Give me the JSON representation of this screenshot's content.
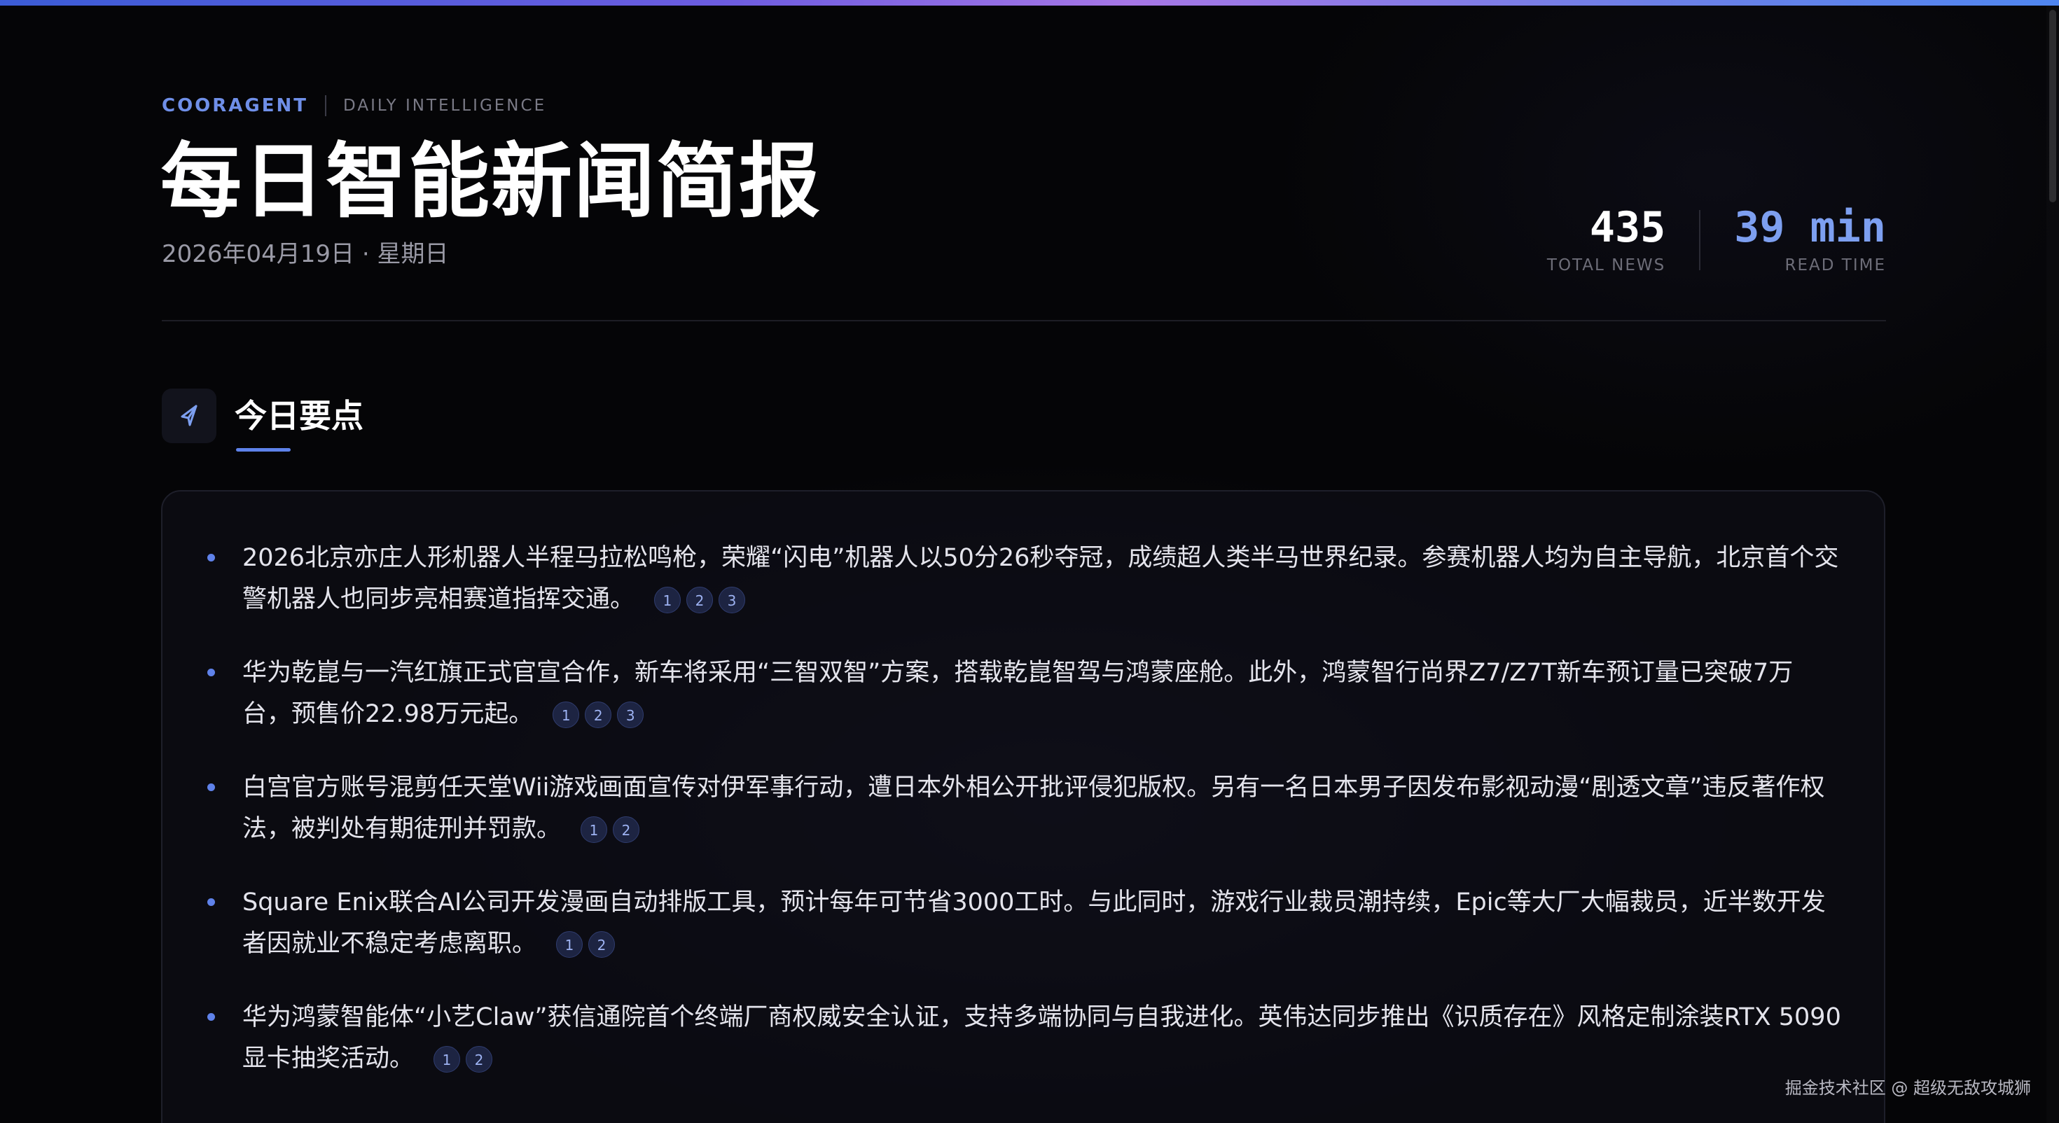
{
  "brand": {
    "name": "COORAGENT",
    "tagline": "DAILY INTELLIGENCE"
  },
  "header": {
    "title": "每日智能新闻简报",
    "date": "2026年04月19日 · 星期日"
  },
  "stats": {
    "total_news": {
      "value": "435",
      "label": "TOTAL NEWS"
    },
    "read_time": {
      "value": "39 min",
      "label": "READ TIME"
    }
  },
  "section": {
    "title": "今日要点",
    "icon": "send-icon"
  },
  "highlights": [
    {
      "text": "2026北京亦庄人形机器人半程马拉松鸣枪，荣耀“闪电”机器人以50分26秒夺冠，成绩超人类半马世界纪录。参赛机器人均为自主导航，北京首个交警机器人也同步亮相赛道指挥交通。",
      "sources": [
        "1",
        "2",
        "3"
      ]
    },
    {
      "text": "华为乾崑与一汽红旗正式官宣合作，新车将采用“三智双智”方案，搭载乾崑智驾与鸿蒙座舱。此外，鸿蒙智行尚界Z7/Z7T新车预订量已突破7万台，预售价22.98万元起。",
      "sources": [
        "1",
        "2",
        "3"
      ]
    },
    {
      "text": "白宫官方账号混剪任天堂Wii游戏画面宣传对伊军事行动，遭日本外相公开批评侵犯版权。另有一名日本男子因发布影视动漫“剧透文章”违反著作权法，被判处有期徒刑并罚款。",
      "sources": [
        "1",
        "2"
      ]
    },
    {
      "text": "Square Enix联合AI公司开发漫画自动排版工具，预计每年可节省3000工时。与此同时，游戏行业裁员潮持续，Epic等大厂大幅裁员，近半数开发者因就业不稳定考虑离职。",
      "sources": [
        "1",
        "2"
      ]
    },
    {
      "text": "华为鸿蒙智能体“小艺Claw”获信通院首个终端厂商权威安全认证，支持多端协同与自我进化。英伟达同步推出《识质存在》风格定制涂装RTX 5090显卡抽奖活动。",
      "sources": [
        "1",
        "2"
      ]
    }
  ],
  "watermark": "掘金技术社区 @ 超级无敌攻城狮",
  "colors": {
    "accent": "#5f82ea",
    "brand": "#6f8fe8",
    "read_time": "#7d9ff0",
    "background": "#050507"
  }
}
